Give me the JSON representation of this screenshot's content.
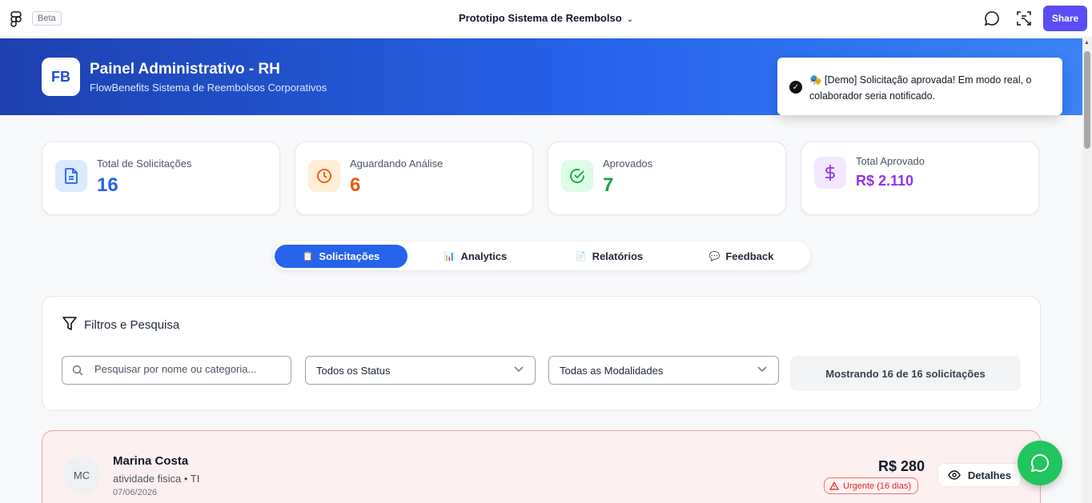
{
  "topbar": {
    "beta_label": "Beta",
    "project_title": "Prototipo Sistema de Reembolso",
    "share_label": "Share"
  },
  "hero": {
    "badge": "FB",
    "title": "Painel Administrativo - RH",
    "subtitle": "FlowBenefits Sistema de Reembolsos Corporativos"
  },
  "toast": {
    "message": "🎭 [Demo] Solicitação aprovada! Em modo real, o colaborador seria notificado."
  },
  "stats": [
    {
      "label": "Total de Solicitações",
      "value": "16",
      "color": "#2563eb",
      "icon": "document-icon"
    },
    {
      "label": "Aguardando Análise",
      "value": "6",
      "color": "#ea580c",
      "icon": "clock-icon"
    },
    {
      "label": "Aprovados",
      "value": "7",
      "color": "#16a34a",
      "icon": "check-circle-icon"
    },
    {
      "label": "Total Aprovado",
      "value": "R$ 2.110",
      "color": "#9333ea",
      "icon": "dollar-icon"
    }
  ],
  "tabs": [
    {
      "label": "Solicitações",
      "emoji": "📋",
      "active": true
    },
    {
      "label": "Analytics",
      "emoji": "📊",
      "active": false
    },
    {
      "label": "Relatórios",
      "emoji": "📄",
      "active": false
    },
    {
      "label": "Feedback",
      "emoji": "💬",
      "active": false
    }
  ],
  "filters": {
    "title": "Filtros e Pesquisa",
    "search_placeholder": "Pesquisar por nome ou categoria...",
    "status_selected": "Todos os Status",
    "modality_selected": "Todas as Modalidades",
    "showing_text": "Mostrando 16 de 16 solicitações"
  },
  "requests": [
    {
      "initials": "MC",
      "name": "Marina Costa",
      "meta": "atividade fisica • TI",
      "date": "07/06/2026",
      "amount": "R$ 280",
      "urgency": "Urgente (16 dias)",
      "details_label": "Detalhes"
    }
  ],
  "colors": {
    "accent": "#2563eb",
    "share": "#5b4cf5",
    "urgent": "#dc2626",
    "whatsapp": "#22c55e"
  }
}
